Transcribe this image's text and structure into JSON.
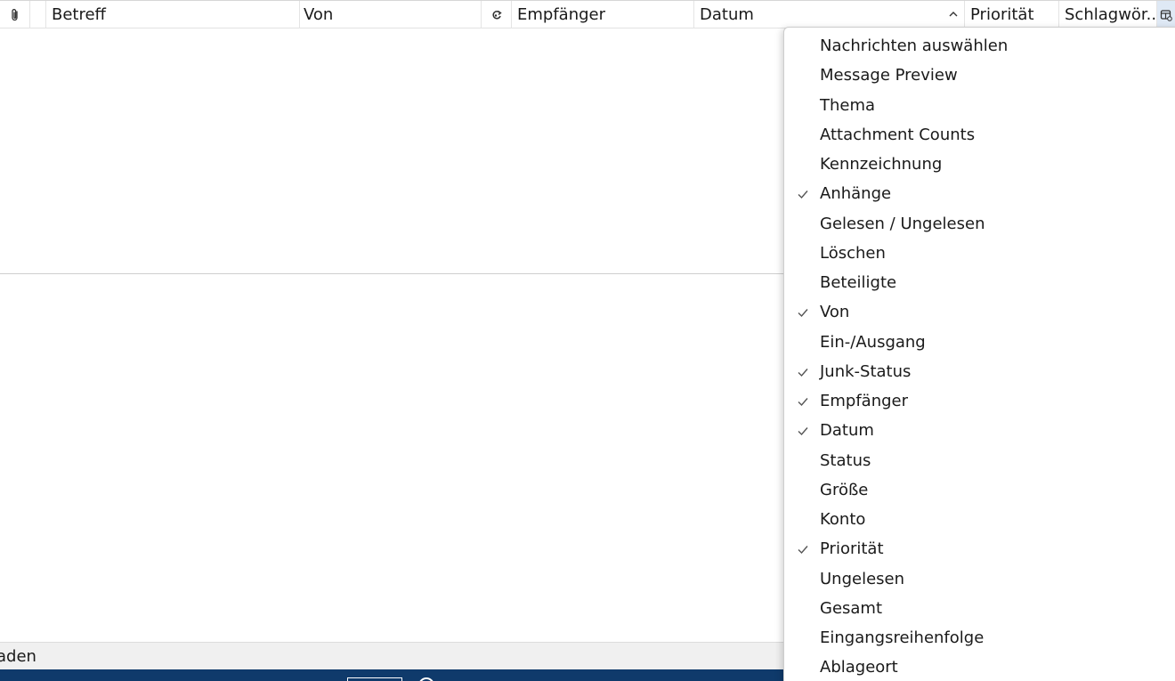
{
  "columns": {
    "attachment_icon": "paperclip-icon",
    "subject": "Betreff",
    "from": "Von",
    "junk_icon": "junk-status-icon",
    "recipient": "Empfänger",
    "date": "Datum",
    "sort_indicator": "chevron-up-icon",
    "priority": "Priorität",
    "tags": "Schlagwör...",
    "picker_icon": "column-picker-icon"
  },
  "status_bar": {
    "text": "aden"
  },
  "colors": {
    "taskbar": "#0f3a6b",
    "picker_bg": "#dfe9f5",
    "status_bar": "#f0f0f0"
  },
  "menu": {
    "items": [
      {
        "label": "Nachrichten auswählen",
        "checked": false
      },
      {
        "label": "Message Preview",
        "checked": false
      },
      {
        "label": "Thema",
        "checked": false
      },
      {
        "label": "Attachment Counts",
        "checked": false
      },
      {
        "label": "Kennzeichnung",
        "checked": false
      },
      {
        "label": "Anhänge",
        "checked": true
      },
      {
        "label": "Gelesen / Ungelesen",
        "checked": false
      },
      {
        "label": "Löschen",
        "checked": false
      },
      {
        "label": "Beteiligte",
        "checked": false
      },
      {
        "label": "Von",
        "checked": true
      },
      {
        "label": "Ein-/Ausgang",
        "checked": false
      },
      {
        "label": "Junk-Status",
        "checked": true
      },
      {
        "label": "Empfänger",
        "checked": true
      },
      {
        "label": "Datum",
        "checked": true
      },
      {
        "label": "Status",
        "checked": false
      },
      {
        "label": "Größe",
        "checked": false
      },
      {
        "label": "Konto",
        "checked": false
      },
      {
        "label": "Priorität",
        "checked": true
      },
      {
        "label": "Ungelesen",
        "checked": false
      },
      {
        "label": "Gesamt",
        "checked": false
      },
      {
        "label": "Eingangsreihenfolge",
        "checked": false
      },
      {
        "label": "Ablageort",
        "checked": false
      }
    ]
  }
}
